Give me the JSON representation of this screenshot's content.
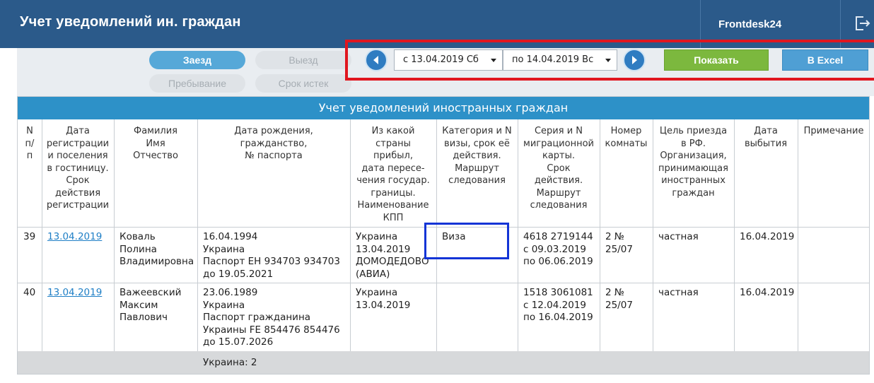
{
  "header": {
    "title": "Учет уведомлений ин. граждан",
    "user": "Frontdesk24",
    "exit_icon": "logout-icon"
  },
  "filters": {
    "tabs": [
      {
        "label": "Заезд",
        "active": true
      },
      {
        "label": "Выезд",
        "active": false
      },
      {
        "label": "Пребывание",
        "active": false
      },
      {
        "label": "Срок истек",
        "active": false
      }
    ],
    "prev_icon": "chevron-left-icon",
    "next_icon": "chevron-right-icon",
    "date_from": "с 13.04.2019 Сб",
    "date_to": "по 14.04.2019 Вс",
    "show_label": "Показать",
    "excel_label": "В Excel"
  },
  "table": {
    "title": "Учет уведомлений иностранных граждан",
    "columns": [
      "N\nп/\nп",
      "Дата\nрегистрации\nи поселения\nв гостиницу.\nСрок\nдействия\nрегистрации",
      "Фамилия\nИмя\nОтчество",
      "Дата рождения,\nгражданство,\n№ паспорта",
      "Из какой\nстраны\nприбыл,\nдата пересе-\nчения государ.\nграницы.\nНаименование\nКПП",
      "Категория и N\nвизы, срок её\nдействия.\nМаршрут\nследования",
      "Серия и N\nмиграционной\nкарты.\nСрок\nдействия.\nМаршрут\nследования",
      "Номер\nкомнаты",
      "Цель приезда\nв РФ.\nОрганизация,\nпринимающая\nиностранных\nграждан",
      "Дата\nвыбытия",
      "Примечание"
    ],
    "rows": [
      {
        "n": "39",
        "reg_date": "13.04.2019",
        "name": "Коваль\nПолина\nВладимировна",
        "birth_passport": "16.04.1994\nУкраина\nПаспорт ЕН 934703 934703\nдо 19.05.2021",
        "from": "Украина\n13.04.2019\nДОМОДЕДОВО\n(АВИА)",
        "visa": "Виза",
        "migration": "4618 2719144\nс 09.03.2019\nпо 06.06.2019",
        "room": "2 №\n25/07",
        "purpose": "частная",
        "departure": "16.04.2019",
        "note": ""
      },
      {
        "n": "40",
        "reg_date": "13.04.2019",
        "name": "Важеевский\nМаксим\nПавлович",
        "birth_passport": "23.06.1989\nУкраина\nПаспорт гражданина\nУкраины FE 854476 854476\nдо 15.07.2026",
        "from": "Украина\n13.04.2019",
        "visa": "",
        "migration": "1518 3061081\nс 12.04.2019\nпо 16.04.2019",
        "room": "2 №\n25/07",
        "purpose": "частная",
        "departure": "16.04.2019",
        "note": ""
      }
    ],
    "summary": "Украина: 2"
  },
  "colors": {
    "topbar": "#2b5a8a",
    "table_header": "#2d91c8",
    "show_button": "#7cb83e",
    "excel_button": "#4f9fd4",
    "highlight_red": "#e0161f",
    "highlight_blue": "#1334d6"
  }
}
